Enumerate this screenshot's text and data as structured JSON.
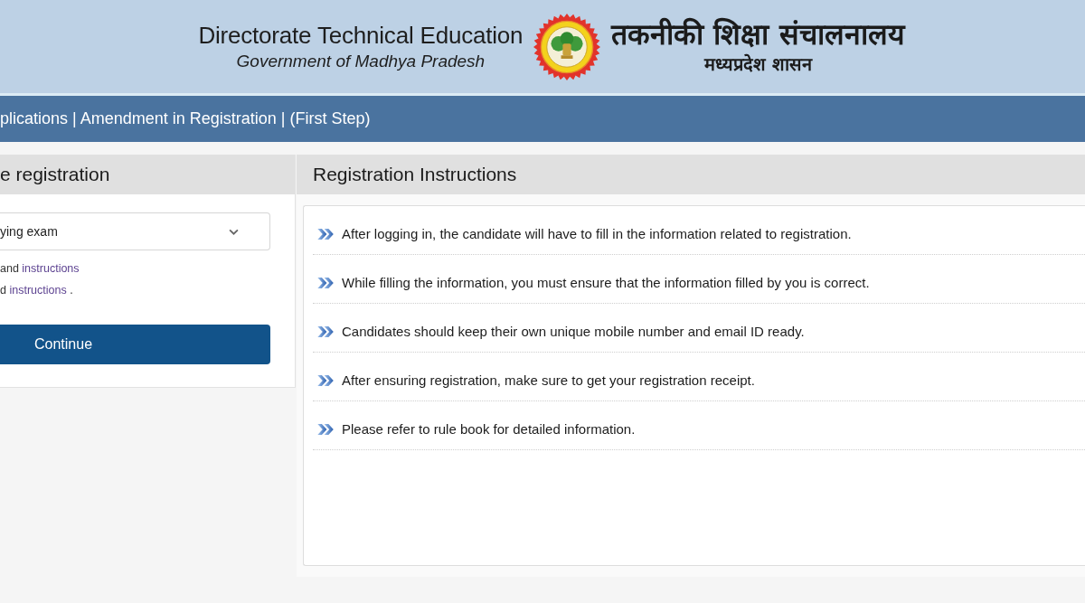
{
  "header": {
    "title": "Directorate Technical Education",
    "subtitle": "Government of Madhya Pradesh",
    "title_hindi": "तकनीकी शिक्षा संचालनालय",
    "subtitle_hindi": "मध्यप्रदेश शासन"
  },
  "breadcrumb": "plications | Amendment in Registration | (First Step)",
  "left_panel": {
    "title": "e registration",
    "select": {
      "value": "ying exam"
    },
    "notes": [
      {
        "text": "and",
        "link": "instructions"
      },
      {
        "text": "d",
        "link": "instructions",
        "tail": "."
      }
    ],
    "button": "Continue"
  },
  "right_panel": {
    "title": "Registration Instructions",
    "items": [
      "After logging in, the candidate will have to fill in the information related to registration.",
      "While filling the information, you must ensure that the information filled by you is correct.",
      "Candidates should keep their own unique mobile number and email ID ready.",
      "After ensuring registration, make sure to get your registration receipt.",
      "Please refer to rule book for detailed information."
    ]
  }
}
